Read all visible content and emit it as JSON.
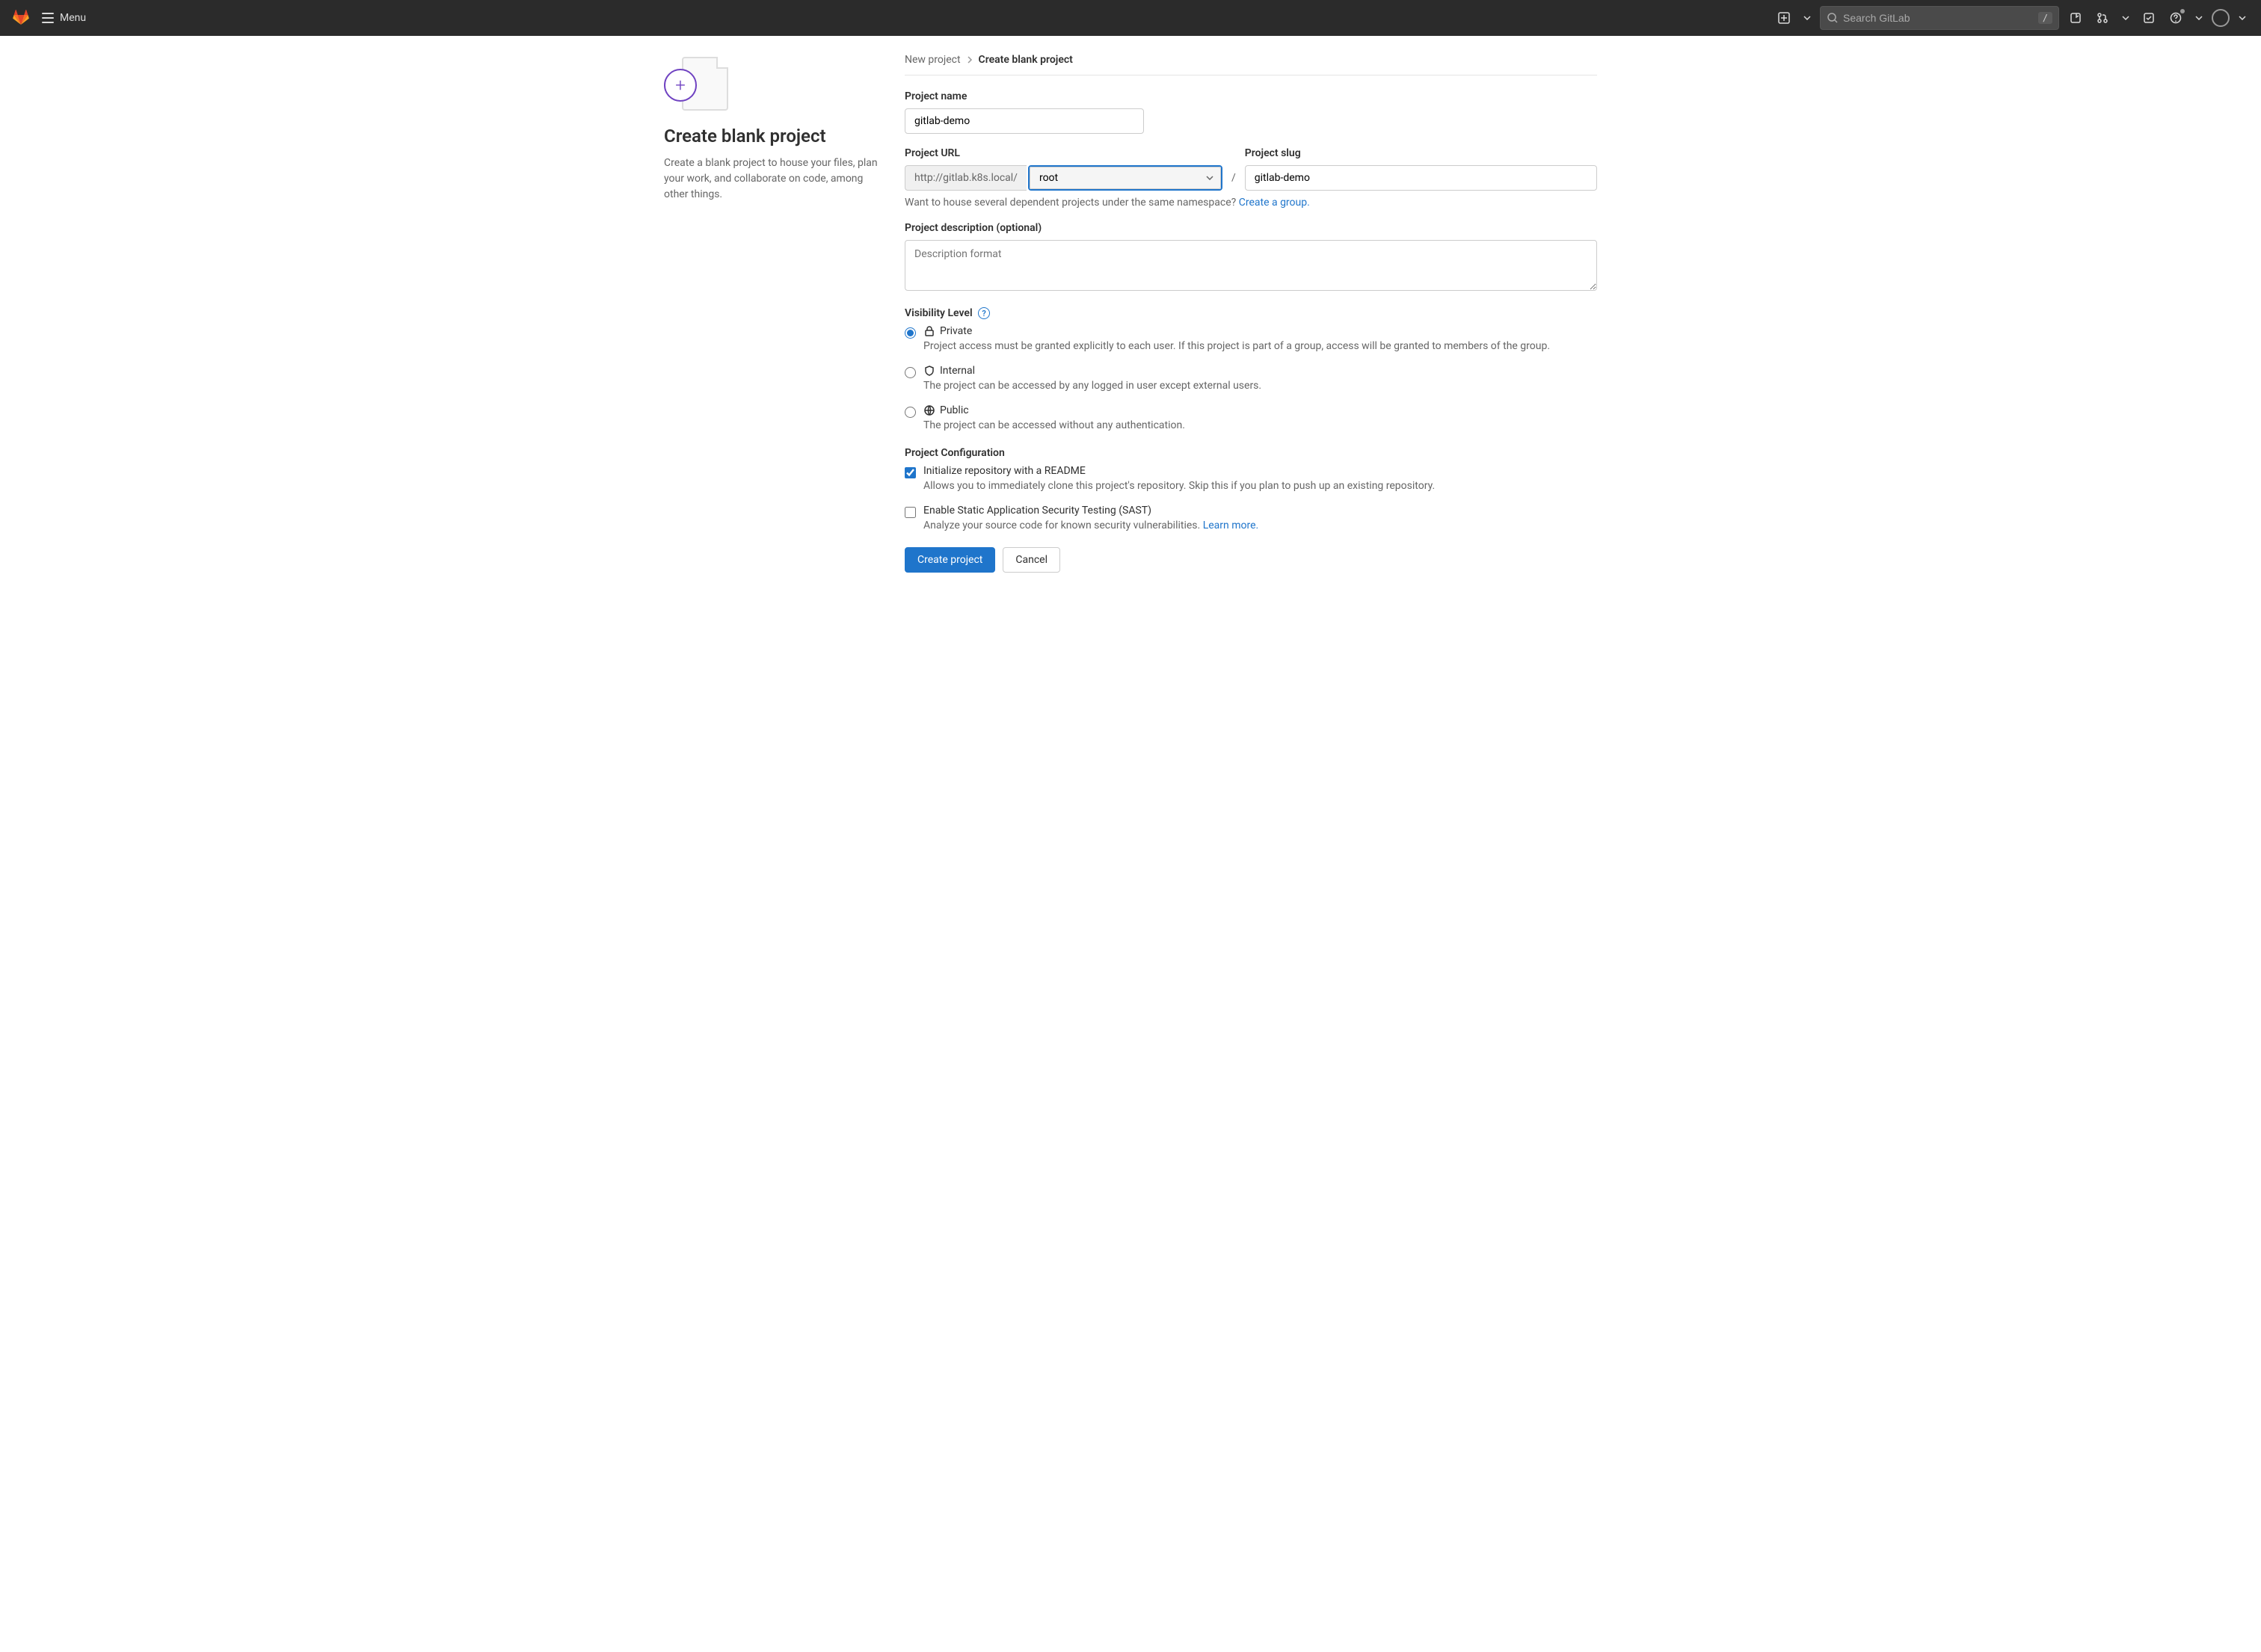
{
  "header": {
    "menu_label": "Menu",
    "search_placeholder": "Search GitLab",
    "search_kbd": "/"
  },
  "sidebar": {
    "title": "Create blank project",
    "description": "Create a blank project to house your files, plan your work, and collaborate on code, among other things."
  },
  "breadcrumb": {
    "parent": "New project",
    "current": "Create blank project"
  },
  "form": {
    "name_label": "Project name",
    "name_value": "gitlab-demo",
    "url_label": "Project URL",
    "url_prefix": "http://gitlab.k8s.local/",
    "namespace_selected": "root",
    "slash": "/",
    "slug_label": "Project slug",
    "slug_value": "gitlab-demo",
    "group_hint_text": "Want to house several dependent projects under the same namespace? ",
    "group_hint_link": "Create a group.",
    "desc_label": "Project description (optional)",
    "desc_placeholder": "Description format",
    "visibility_label": "Visibility Level",
    "visibility": {
      "private": {
        "label": "Private",
        "desc": "Project access must be granted explicitly to each user. If this project is part of a group, access will be granted to members of the group."
      },
      "internal": {
        "label": "Internal",
        "desc": "The project can be accessed by any logged in user except external users."
      },
      "public": {
        "label": "Public",
        "desc": "The project can be accessed without any authentication."
      }
    },
    "config_label": "Project Configuration",
    "readme": {
      "label": "Initialize repository with a README",
      "desc": "Allows you to immediately clone this project's repository. Skip this if you plan to push up an existing repository."
    },
    "sast": {
      "label": "Enable Static Application Security Testing (SAST)",
      "desc_text": "Analyze your source code for known security vulnerabilities. ",
      "desc_link": "Learn more."
    },
    "submit": "Create project",
    "cancel": "Cancel"
  }
}
